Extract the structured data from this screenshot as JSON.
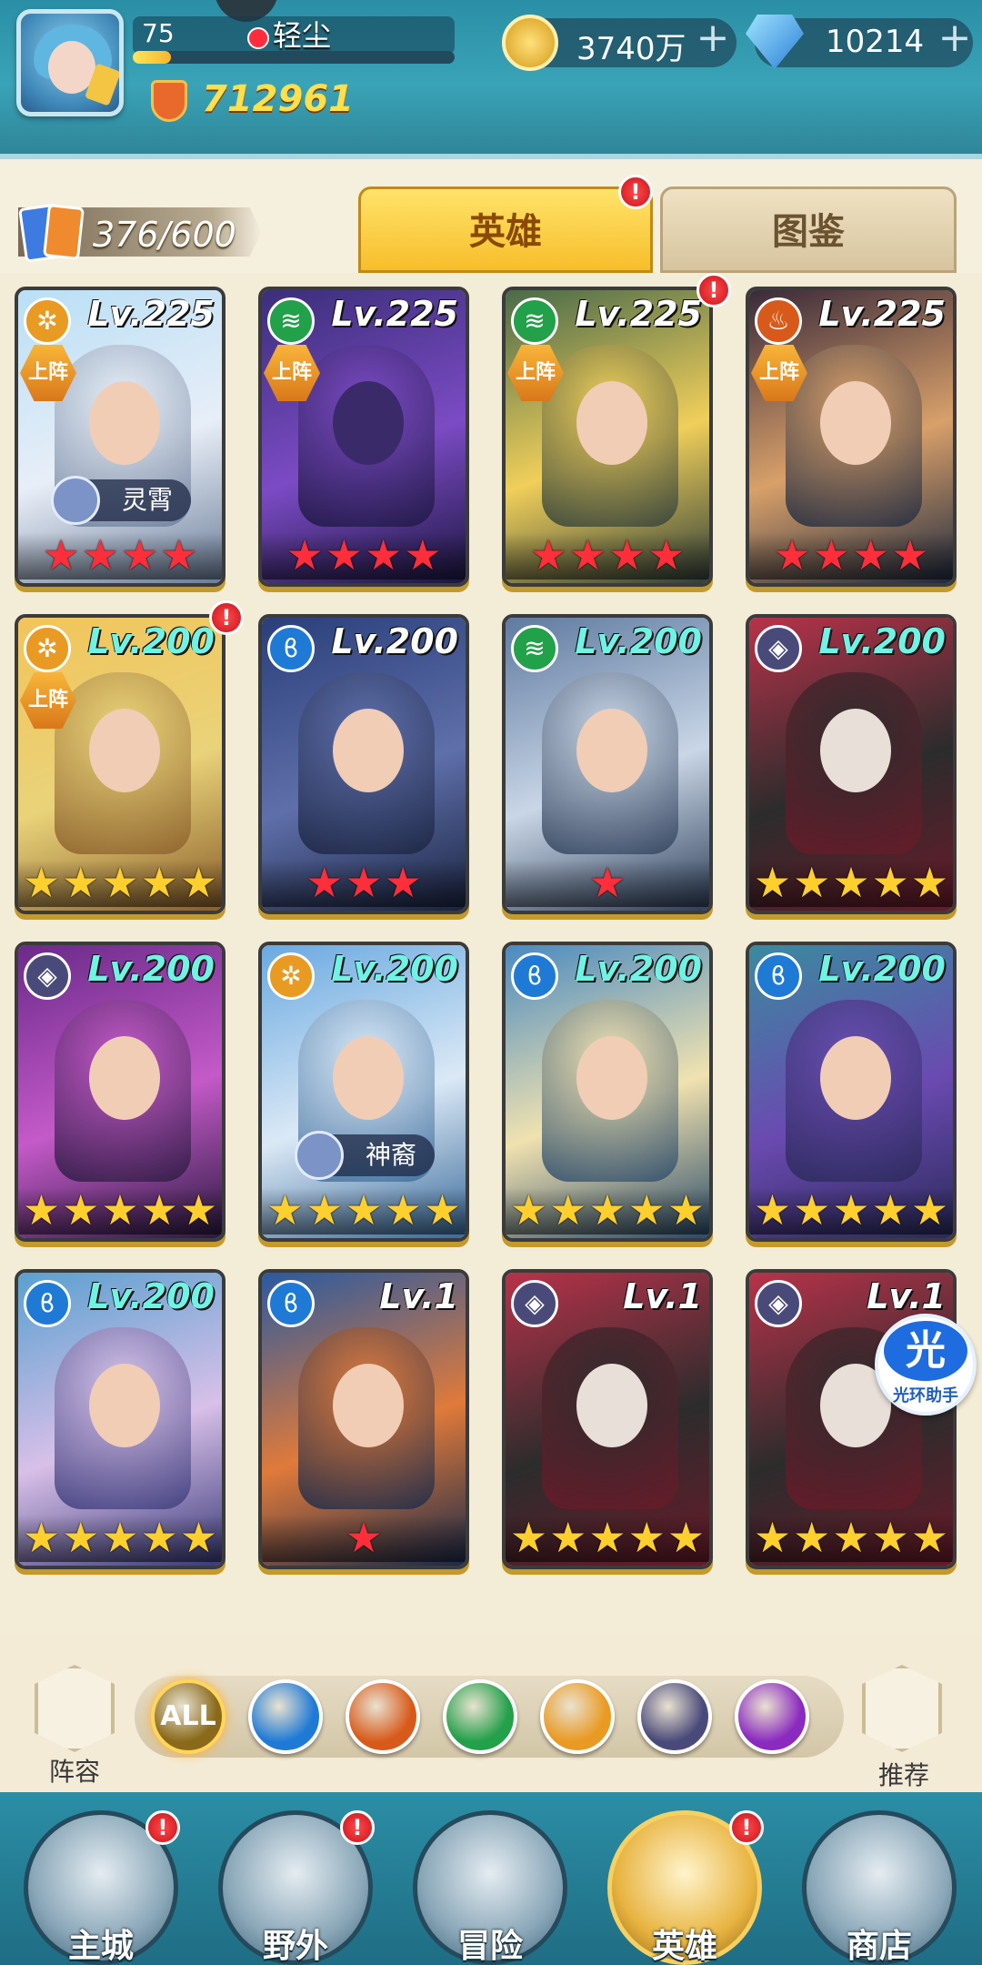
{
  "header": {
    "player_level": "75",
    "player_name": "轻尘",
    "xp_progress": 0.12,
    "combat_power": "712961",
    "gold": "3740万",
    "gems": "10214"
  },
  "tabs": {
    "card_count": "376/600",
    "heroes_label": "英雄",
    "codex_label": "图鉴",
    "heroes_badge": "!"
  },
  "hero_cards": [
    {
      "faction": "light",
      "level": "Lv.225",
      "on_team": "上阵",
      "title": "灵霄",
      "stars": 4,
      "star_color": "red",
      "badge": "",
      "art": [
        "#b9dff6",
        "#e8eef7",
        "#6b7d99"
      ]
    },
    {
      "faction": "nature",
      "level": "Lv.225",
      "on_team": "上阵",
      "title": "",
      "stars": 4,
      "star_color": "red",
      "badge": "",
      "art": [
        "#3b2f7a",
        "#7b4bc4",
        "#1c1740"
      ]
    },
    {
      "faction": "nature",
      "level": "Lv.225",
      "on_team": "上阵",
      "title": "",
      "stars": 4,
      "star_color": "red",
      "badge": "!",
      "art": [
        "#4a6a4a",
        "#f0cf5a",
        "#2f3f3a"
      ]
    },
    {
      "faction": "fire",
      "level": "Lv.225",
      "on_team": "上阵",
      "title": "",
      "stars": 4,
      "star_color": "red",
      "badge": "",
      "art": [
        "#3a2a3a",
        "#d8a06a",
        "#1f2a40"
      ]
    },
    {
      "faction": "light",
      "level": "Lv.200",
      "on_team": "上阵",
      "title": "",
      "stars": 5,
      "star_color": "gold",
      "badge": "!",
      "art": [
        "#f2c45a",
        "#e9d37a",
        "#8a5e2a"
      ]
    },
    {
      "faction": "water",
      "level": "Lv.200",
      "on_team": "",
      "title": "",
      "stars": 3,
      "star_color": "red",
      "badge": "",
      "art": [
        "#2a3f7a",
        "#5f6faa",
        "#1a2440"
      ]
    },
    {
      "faction": "nature",
      "level": "Lv.200",
      "on_team": "",
      "title": "",
      "stars": 1,
      "star_color": "red",
      "badge": "",
      "art": [
        "#5f7aa0",
        "#c9d6e6",
        "#2f3f5a"
      ]
    },
    {
      "faction": "void",
      "level": "Lv.200",
      "on_team": "",
      "title": "",
      "stars": 5,
      "star_color": "gold",
      "badge": "",
      "art": [
        "#b8324a",
        "#2c2c2c",
        "#6a1a2a"
      ]
    },
    {
      "faction": "void",
      "level": "Lv.200",
      "on_team": "",
      "title": "",
      "stars": 5,
      "star_color": "gold",
      "badge": "",
      "art": [
        "#6a2a8a",
        "#c45ac8",
        "#2a1a40"
      ]
    },
    {
      "faction": "light",
      "level": "Lv.200",
      "on_team": "",
      "title": "神裔",
      "stars": 5,
      "star_color": "gold",
      "badge": "",
      "art": [
        "#6aa9e0",
        "#dbe9f6",
        "#3a6a9a"
      ]
    },
    {
      "faction": "water",
      "level": "Lv.200",
      "on_team": "",
      "title": "",
      "stars": 5,
      "star_color": "gold",
      "badge": "",
      "art": [
        "#4a8ac0",
        "#f0e2b0",
        "#2a4a6a"
      ]
    },
    {
      "faction": "water",
      "level": "Lv.200",
      "on_team": "",
      "title": "",
      "stars": 5,
      "star_color": "gold",
      "badge": "",
      "art": [
        "#3a8aa0",
        "#6a4ab0",
        "#2a2a5a"
      ]
    },
    {
      "faction": "water",
      "level": "Lv.200",
      "on_team": "",
      "title": "",
      "stars": 5,
      "star_color": "gold",
      "badge": "",
      "art": [
        "#5aa0d0",
        "#d8c0e8",
        "#3a3a7a"
      ]
    },
    {
      "faction": "water",
      "level": "Lv.1",
      "on_team": "",
      "title": "",
      "stars": 1,
      "star_color": "red",
      "badge": "",
      "art": [
        "#2a5aa0",
        "#e07a3a",
        "#1a2a4a"
      ]
    },
    {
      "faction": "void",
      "level": "Lv.1",
      "on_team": "",
      "title": "",
      "stars": 5,
      "star_color": "gold",
      "badge": "",
      "art": [
        "#b8324a",
        "#2c2c2c",
        "#6a1a2a"
      ]
    },
    {
      "faction": "void",
      "level": "Lv.1",
      "on_team": "",
      "title": "",
      "stars": 5,
      "star_color": "gold",
      "badge": "",
      "art": [
        "#b8324a",
        "#2c2c2c",
        "#6a1a2a"
      ]
    }
  ],
  "faction_colors": {
    "light": "#e99a22",
    "nature": "#23a04a",
    "fire": "#d85a1a",
    "water": "#1f7ad6",
    "void": "#4a4a7a"
  },
  "filter": {
    "lineup_label": "阵容",
    "recommend_label": "推荐",
    "buttons": [
      {
        "name": "all",
        "label": "ALL",
        "color": "#8a6a1a",
        "selected": true
      },
      {
        "name": "water",
        "label": "",
        "color": "#1f7ad6",
        "selected": false
      },
      {
        "name": "fire",
        "label": "",
        "color": "#d85a1a",
        "selected": false
      },
      {
        "name": "nature",
        "label": "",
        "color": "#23a04a",
        "selected": false
      },
      {
        "name": "light",
        "label": "",
        "color": "#e99a22",
        "selected": false
      },
      {
        "name": "void",
        "label": "",
        "color": "#4a4a7a",
        "selected": false
      },
      {
        "name": "arcane",
        "label": "",
        "color": "#8a2ac0",
        "selected": false
      }
    ]
  },
  "helper": {
    "glyph": "光",
    "label": "光环助手"
  },
  "nav": [
    {
      "label": "主城",
      "badge": "!",
      "active": false
    },
    {
      "label": "野外",
      "badge": "!",
      "active": false
    },
    {
      "label": "冒险",
      "badge": "",
      "active": false
    },
    {
      "label": "英雄",
      "badge": "!",
      "active": true
    },
    {
      "label": "商店",
      "badge": "",
      "active": false
    }
  ]
}
